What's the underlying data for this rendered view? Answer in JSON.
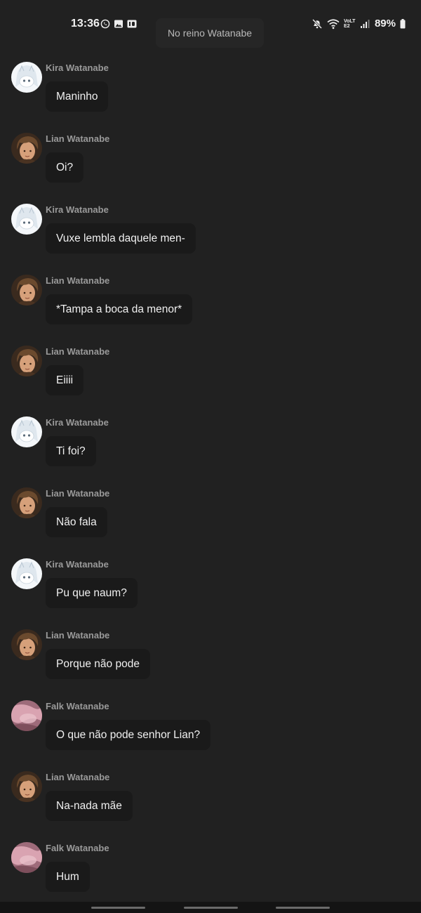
{
  "status_bar": {
    "time": "13:36",
    "left_icons": [
      "whatsapp-icon",
      "gallery-icon",
      "hd-icon"
    ],
    "right_icons": [
      "mute-icon",
      "wifi-icon",
      "volte-icon",
      "signal-icon"
    ],
    "volte_label": "VoLTE2",
    "battery_percent": "89%"
  },
  "chat": {
    "title": "No reino Watanabe"
  },
  "avatar_colors": {
    "kira": "#e6eef3",
    "lian": "#6b4a2e",
    "falk": "#c98a9a"
  },
  "messages": [
    {
      "sender": "Kira Watanabe",
      "avatar": "kira",
      "text": "Maninho"
    },
    {
      "sender": "Lian Watanabe",
      "avatar": "lian",
      "text": "Oi?"
    },
    {
      "sender": "Kira Watanabe",
      "avatar": "kira",
      "text": "Vuxe lembla daquele men-"
    },
    {
      "sender": "Lian Watanabe",
      "avatar": "lian",
      "text": "*Tampa a boca da menor*"
    },
    {
      "sender": "Lian Watanabe",
      "avatar": "lian",
      "text": "Eiiii"
    },
    {
      "sender": "Kira Watanabe",
      "avatar": "kira",
      "text": "Ti foi?"
    },
    {
      "sender": "Lian Watanabe",
      "avatar": "lian",
      "text": "Não fala"
    },
    {
      "sender": "Kira Watanabe",
      "avatar": "kira",
      "text": "Pu que naum?"
    },
    {
      "sender": "Lian Watanabe",
      "avatar": "lian",
      "text": "Porque não pode"
    },
    {
      "sender": "Falk Watanabe",
      "avatar": "falk",
      "text": "O que não pode senhor Lian?"
    },
    {
      "sender": "Lian Watanabe",
      "avatar": "lian",
      "text": "Na-nada mãe"
    },
    {
      "sender": "Falk Watanabe",
      "avatar": "falk",
      "text": "Hum"
    }
  ]
}
